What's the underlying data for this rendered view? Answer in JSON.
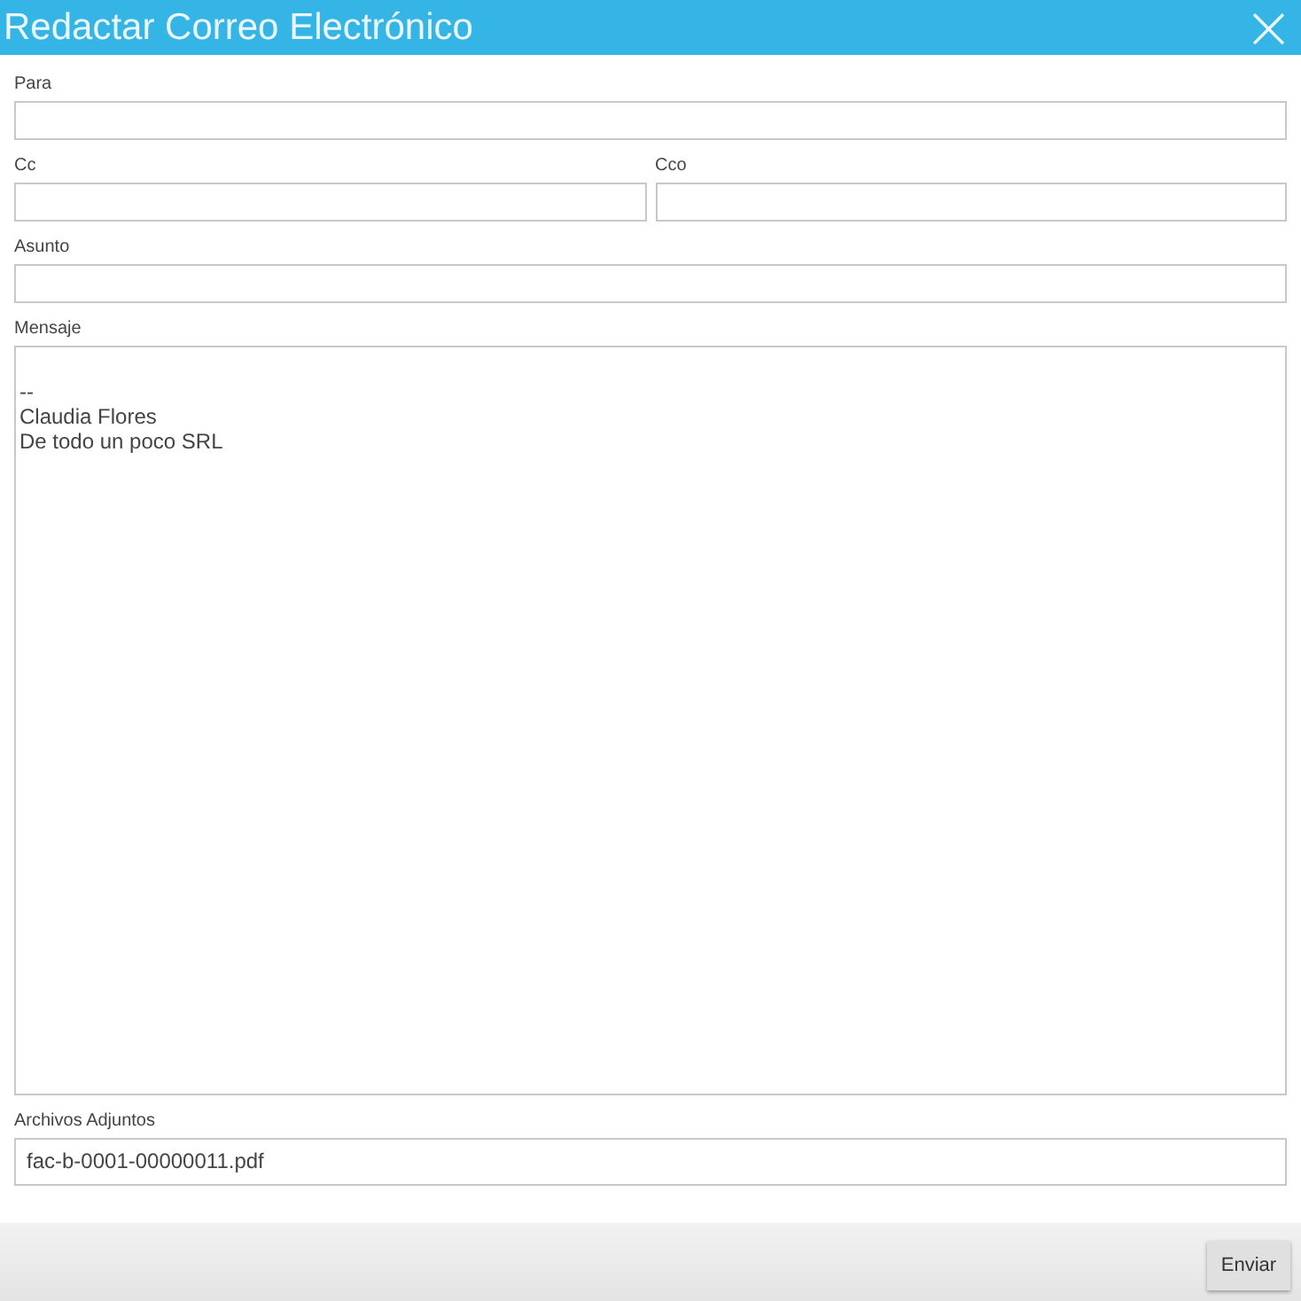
{
  "window": {
    "title": "Redactar Correo Electrónico",
    "close": "×"
  },
  "fields": [
    {
      "label": "Para"
    },
    {
      "label": "Cc"
    },
    {
      "label": "Cco"
    },
    {
      "label": "Asunto"
    }
  ],
  "message": {
    "label": "Mensaje",
    "value": "\n--\nClaudia Flores\nDe todo un poco SRL"
  },
  "attachments": {
    "label": "Archivos Adjuntos",
    "value": "fac-b-0001-00000011.pdf"
  },
  "buttons": [
    "Enviar"
  ]
}
